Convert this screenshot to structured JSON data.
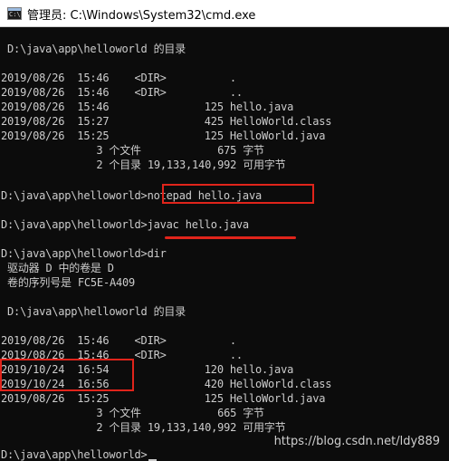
{
  "window": {
    "title": "管理员: C:\\Windows\\System32\\cmd.exe",
    "icon": "cmd-icon",
    "icon_glyph": "C:\\"
  },
  "console": {
    "lines": [
      "",
      " D:\\java\\app\\helloworld 的目录",
      "",
      "2019/08/26  15:46    <DIR>          .",
      "2019/08/26  15:46    <DIR>          ..",
      "2019/08/26  15:46               125 hello.java",
      "2019/08/26  15:27               425 HelloWorld.class",
      "2019/08/26  15:25               125 HelloWorld.java",
      "               3 个文件            675 字节",
      "               2 个目录 19,133,140,992 可用字节",
      "",
      "D:\\java\\app\\helloworld>notepad hello.java",
      "",
      "D:\\java\\app\\helloworld>javac hello.java",
      "",
      "D:\\java\\app\\helloworld>dir",
      " 驱动器 D 中的卷是 D",
      " 卷的序列号是 FC5E-A409",
      "",
      " D:\\java\\app\\helloworld 的目录",
      "",
      "2019/08/26  15:46    <DIR>          .",
      "2019/08/26  15:46    <DIR>          ..",
      "2019/10/24  16:54               120 hello.java",
      "2019/10/24  16:56               420 HelloWorld.class",
      "2019/08/26  15:25               125 HelloWorld.java",
      "               3 个文件            665 字节",
      "               2 个目录 19,133,140,992 可用字节",
      "",
      "D:\\java\\app\\helloworld>"
    ]
  },
  "watermark": "https://blog.csdn.net/ldy889",
  "colors": {
    "console_background": "#0c0c0c",
    "console_text": "#cccccc",
    "annotation": "#e0241b",
    "titlebar": "#ffffff"
  }
}
